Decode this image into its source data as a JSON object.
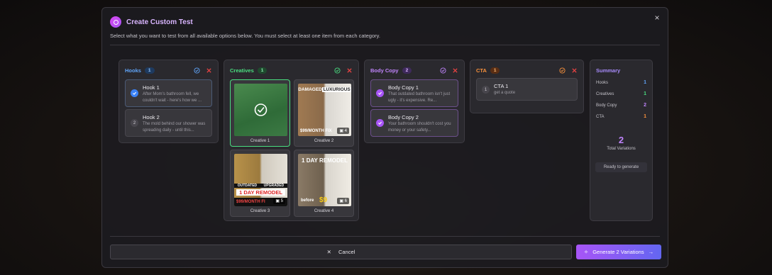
{
  "modal": {
    "title": "Create Custom Test",
    "subtitle": "Select what you want to test from all available options below. You must select at least one item from each category.",
    "close_label": "×"
  },
  "hooks": {
    "title": "Hooks",
    "count": "1",
    "color": "#60a5fa",
    "items": [
      {
        "title": "Hook 1",
        "desc": "After Mom's bathroom fell, we couldn't wait - here's how we ...",
        "selected": true
      },
      {
        "title": "Hook 2",
        "desc": "The mold behind our shower was spreading daily - until this...",
        "selected": false,
        "index": "2"
      }
    ]
  },
  "creatives": {
    "title": "Creatives",
    "count": "1",
    "color": "#4ade80",
    "items": [
      {
        "label": "Creative 1",
        "selected": true
      },
      {
        "label": "Creative 2",
        "top_text_left": "DAMAGED",
        "top_text_right": "LUXURIOUS",
        "price": "$99/MONTH FIX",
        "img_count": "4"
      },
      {
        "label": "Creative 3",
        "left_tag": "OUTDATED",
        "right_tag": "UPGRADED",
        "banner": "1 DAY REMODEL",
        "price": "$99/MONTH FI",
        "img_count": "5"
      },
      {
        "label": "Creative 4",
        "top_text": "1 DAY REMODEL",
        "before": "before",
        "price": "$9",
        "img_count": "6"
      }
    ]
  },
  "body_copy": {
    "title": "Body Copy",
    "count": "2",
    "color": "#c084fc",
    "items": [
      {
        "title": "Body Copy 1",
        "desc": "That outdated bathroom isn't just ugly - it's expensive. Re...",
        "selected": true
      },
      {
        "title": "Body Copy 2",
        "desc": "Your bathroom shouldn't cost you money or your safety...",
        "selected": true
      }
    ]
  },
  "cta": {
    "title": "CTA",
    "count": "1",
    "color": "#fb923c",
    "items": [
      {
        "title": "CTA 1",
        "desc": "get a quote",
        "index": "1"
      }
    ]
  },
  "summary": {
    "title": "Summary",
    "rows": [
      {
        "label": "Hooks",
        "value": "1",
        "color": "#60a5fa"
      },
      {
        "label": "Creatives",
        "value": "1",
        "color": "#4ade80"
      },
      {
        "label": "Body Copy",
        "value": "2",
        "color": "#c084fc"
      },
      {
        "label": "CTA",
        "value": "1",
        "color": "#fb923c"
      }
    ],
    "total": "2",
    "total_label": "Total Variations",
    "status": "Ready to generate"
  },
  "footer": {
    "cancel_label": "Cancel",
    "generate_label": "Generate 2 Variations"
  }
}
